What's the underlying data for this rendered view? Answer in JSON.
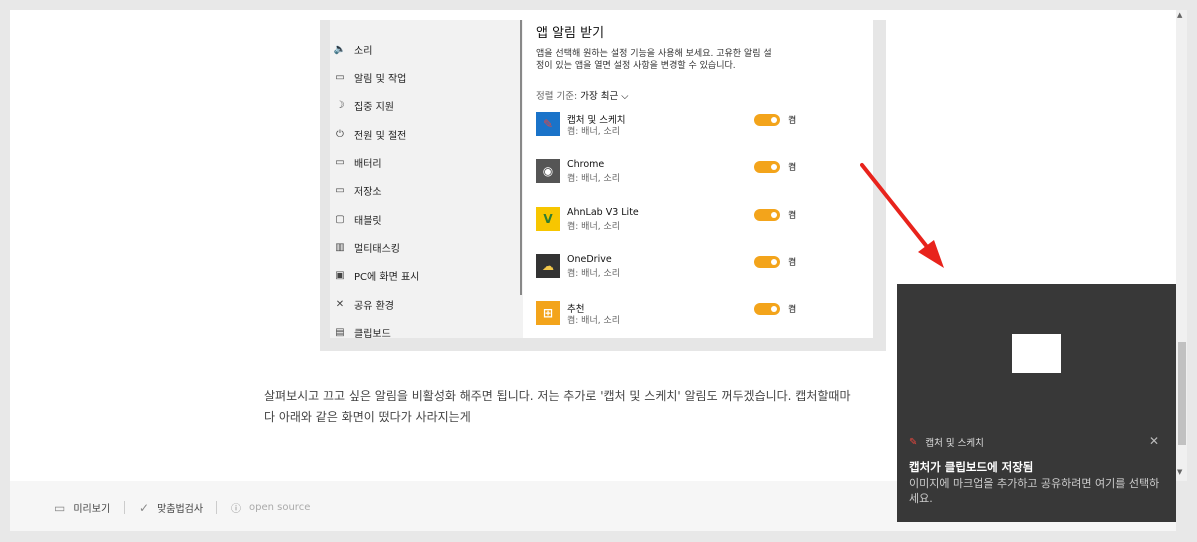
{
  "settings_sidebar": {
    "items": [
      {
        "label": "소리",
        "icon": "speaker-icon",
        "glyph": "🔈"
      },
      {
        "label": "알림 및 작업",
        "icon": "notification-icon",
        "glyph": "▭"
      },
      {
        "label": "집중 지원",
        "icon": "moon-icon",
        "glyph": "☽"
      },
      {
        "label": "전원 및 절전",
        "icon": "power-icon",
        "glyph": "⏻"
      },
      {
        "label": "배터리",
        "icon": "battery-icon",
        "glyph": "▭"
      },
      {
        "label": "저장소",
        "icon": "storage-icon",
        "glyph": "▭"
      },
      {
        "label": "태블릿",
        "icon": "tablet-icon",
        "glyph": "▢"
      },
      {
        "label": "멀티태스킹",
        "icon": "multitasking-icon",
        "glyph": "▥"
      },
      {
        "label": "PC에 화면 표시",
        "icon": "project-icon",
        "glyph": "▣"
      },
      {
        "label": "공유 환경",
        "icon": "shared-icon",
        "glyph": "✕"
      },
      {
        "label": "클립보드",
        "icon": "clipboard-icon",
        "glyph": "▤"
      }
    ]
  },
  "settings_panel": {
    "title": "앱 알림 받기",
    "description": "앱을 선택해 원하는 설정 기능을 사용해 보세요. 고유한 알림 설정이 있는 앱을 열면 설정 사항을 변경할 수 있습니다.",
    "sort_label": "정렬 기준:",
    "sort_value": "가장 최근 ⌵",
    "apps": [
      {
        "name": "캡처 및 스케치",
        "sub": "켬: 배너, 소리",
        "state": "켬",
        "icon_bg": "#1a73c9",
        "icon_fg": "#e8463d",
        "glyph": "✎",
        "icon": "snip-sketch-icon"
      },
      {
        "name": "Chrome",
        "sub": "켬: 배너, 소리",
        "state": "켬",
        "icon_bg": "#555555",
        "icon_fg": "#ffffff",
        "glyph": "◉",
        "icon": "chrome-icon"
      },
      {
        "name": "AhnLab V3 Lite",
        "sub": "켬: 배너, 소리",
        "state": "켬",
        "icon_bg": "#f7c600",
        "icon_fg": "#2e7d32",
        "glyph": "V",
        "icon": "ahnlab-icon"
      },
      {
        "name": "OneDrive",
        "sub": "켬: 배너, 소리",
        "state": "켬",
        "icon_bg": "#333333",
        "icon_fg": "#f3c84a",
        "glyph": "☁",
        "icon": "onedrive-icon"
      },
      {
        "name": "추천",
        "sub": "켬: 배너, 소리",
        "state": "켬",
        "icon_bg": "#f3a41b",
        "icon_fg": "#ffffff",
        "glyph": "⊞",
        "icon": "suggested-icon"
      }
    ]
  },
  "article": {
    "line1": "살펴보시고 끄고 싶은 알림을 비활성화 해주면 됩니다. 저는 추가로 '캡처 및 스케치' 알림도 꺼두겠습니다. 캡처할때마",
    "line2": "다 아래와 같은 화면이 떴다가 사라지는게"
  },
  "bottom_bar": {
    "preview": "미리보기",
    "spellcheck": "맞춤법검사",
    "open_source": "open source"
  },
  "toast": {
    "app_name": "캡처 및 스케치",
    "title": "캡처가 클립보드에 저장됨",
    "body": "이미지에 마크업을 추가하고 공유하려면 여기를 선택하세요.",
    "close": "✕"
  },
  "colors": {
    "toggle_on": "#f3a41b",
    "arrow": "#e8231c",
    "toast_bg": "#383838"
  }
}
